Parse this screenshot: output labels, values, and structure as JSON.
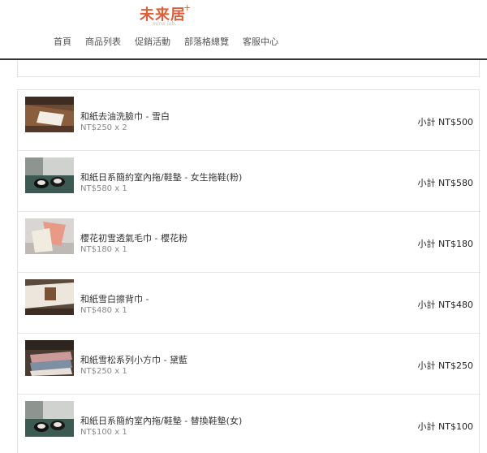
{
  "header": {
    "logo_text": "未来居",
    "logo_plus": "+",
    "logo_subtitle": "mirai lab.",
    "nav": [
      "首頁",
      "商品列表",
      "促銷活動",
      "部落格總覽",
      "客服中心"
    ]
  },
  "cart": {
    "items": [
      {
        "name": "和紙去油洗臉巾 - 雪白",
        "price": "NT$250 x 2",
        "subtotal": "小計 NT$500",
        "thumb_icon": "towel-on-wood-photo"
      },
      {
        "name": "和紙日系簡約室內拖/鞋墊 - 女生拖鞋(粉)",
        "price": "NT$580 x 1",
        "subtotal": "小計 NT$580",
        "thumb_icon": "slippers-photo"
      },
      {
        "name": "櫻花初雪透氣毛巾 - 櫻花粉",
        "price": "NT$180 x 1",
        "subtotal": "小計 NT$180",
        "thumb_icon": "pink-towel-photo"
      },
      {
        "name": "和紙雪白擦背巾 -",
        "price": "NT$480 x 1",
        "subtotal": "小計 NT$480",
        "thumb_icon": "back-towel-photo"
      },
      {
        "name": "和紙雪松系列小方巾 - 黛藍",
        "price": "NT$250 x 1",
        "subtotal": "小計 NT$250",
        "thumb_icon": "folded-towels-photo"
      },
      {
        "name": "和紙日系簡約室內拖/鞋墊 - 替換鞋墊(女)",
        "price": "NT$100 x 1",
        "subtotal": "小計 NT$100",
        "thumb_icon": "slippers-photo"
      }
    ]
  },
  "colors": {
    "brand": "#d9603b",
    "border": "#e2e2e2",
    "text": "#333333",
    "muted": "#888888"
  }
}
